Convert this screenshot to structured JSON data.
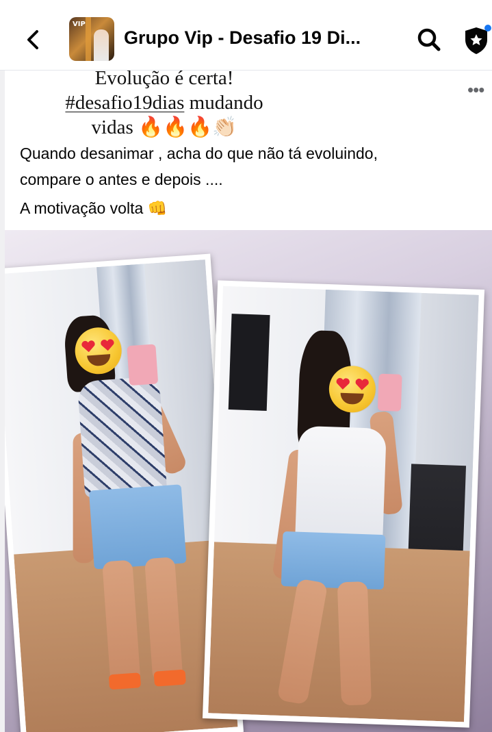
{
  "header": {
    "back_icon": "chevron-left-icon",
    "avatar_text": "VIP",
    "group_title": "Grupo Vip - Desafio 19 Di...",
    "search_icon": "search-icon",
    "shield_icon": "shield-star-icon",
    "notification_dot_color": "#1877f2"
  },
  "post": {
    "more_label": "•••",
    "headline": {
      "line1": "Evolução é certa!",
      "hashtag": "#desafio19dias",
      "line2_rest": " mudando",
      "line3": "vidas 🔥🔥🔥👏🏻"
    },
    "body": {
      "line1": "Quando desanimar , acha do que não tá evoluindo,",
      "line2": "compare o antes e depois ....",
      "line3": "A motivação volta 👊"
    }
  },
  "photo": {
    "description_icons": [
      "heart-eyes-emoji-icon",
      "heart-eyes-emoji-icon"
    ],
    "background_color": "#b3a6bf"
  }
}
